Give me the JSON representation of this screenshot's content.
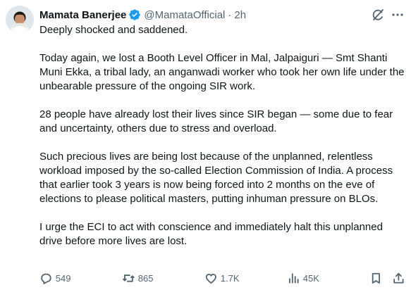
{
  "tweet": {
    "author_name": "Mamata Banerjee",
    "handle": "@MamataOfficial",
    "separator": "·",
    "time": "2h",
    "verified_icon": "verified-badge-icon",
    "paragraphs": [
      "Deeply shocked and saddened.",
      "Today again, we lost a Booth Level Officer in Mal, Jalpaiguri — Smt Shanti Muni Ekka, a tribal lady, an anganwadi worker who took her own life under the unbearable pressure of the ongoing SIR work.",
      "28 people have already lost their lives since SIR began — some due to fear and uncertainty, others due to stress and overload.",
      "Such precious lives are being lost because of the unplanned, relentless workload imposed by the so-called Election Commission of India. A process that earlier took 3 years is now being forced into 2 months on the eve of elections to please political masters, putting inhuman pressure on BLOs.",
      "I urge the ECI to act with conscience and immediately halt this unplanned drive before more lives are lost."
    ],
    "actions": {
      "replies": "549",
      "reposts": "865",
      "likes": "1.7K",
      "views": "45K"
    }
  },
  "colors": {
    "text": "#0f1419",
    "secondary": "#536471",
    "verified": "#1d9bf0",
    "background": "#ffffff"
  }
}
